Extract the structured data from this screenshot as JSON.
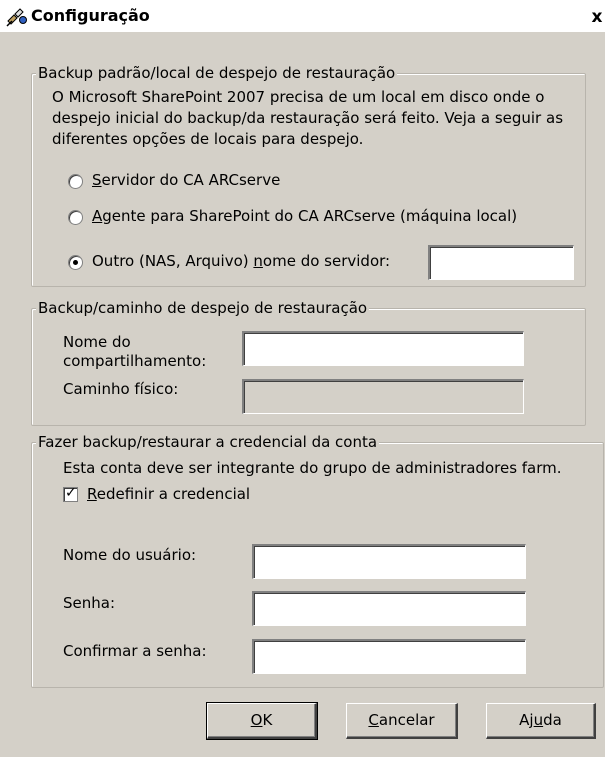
{
  "window": {
    "title": "Configuração",
    "close_glyph": "x"
  },
  "group_dump": {
    "legend": "Backup padrão/local de despejo de restauração",
    "description": "O Microsoft SharePoint 2007 precisa de um local em disco onde o despejo inicial do backup/da restauração será feito. Veja a seguir as diferentes opções de locais para despejo.",
    "options": [
      {
        "mnemonic": "S",
        "rest": "ervidor do CA ARCserve",
        "selected": false
      },
      {
        "mnemonic": "A",
        "rest": "gente para SharePoint do CA ARCserve (máquina local)",
        "selected": false
      },
      {
        "pre": "Outro (NAS, Arquivo) ",
        "mnemonic": "n",
        "rest": "ome do servidor:",
        "selected": true
      }
    ],
    "server_value": ""
  },
  "group_path": {
    "legend": "Backup/caminho de despejo de restauração",
    "share_label_line1": "Nome do",
    "share_label_line2": "compartilhamento:",
    "share_value": "",
    "physical_label": "Caminho físico:",
    "physical_value": ""
  },
  "group_credential": {
    "legend": "Fazer backup/restaurar a credencial da conta",
    "description": "Esta conta deve ser integrante do grupo de administradores farm.",
    "reset_mnemonic": "R",
    "reset_rest": "edefinir a credencial",
    "reset_checked": true,
    "username_label": "Nome do usuário:",
    "username_value": "",
    "password_label": "Senha:",
    "password_value": "",
    "confirm_label": "Confirmar a senha:",
    "confirm_value": ""
  },
  "buttons": {
    "ok_mnemonic": "O",
    "ok_rest": "K",
    "cancel_mnemonic": "C",
    "cancel_rest": "ancelar",
    "help_pre": "Aj",
    "help_mnemonic": "u",
    "help_rest": "da"
  },
  "colors": {
    "dialog_bg": "#d4d0c8",
    "title_bg": "#ffffff"
  }
}
